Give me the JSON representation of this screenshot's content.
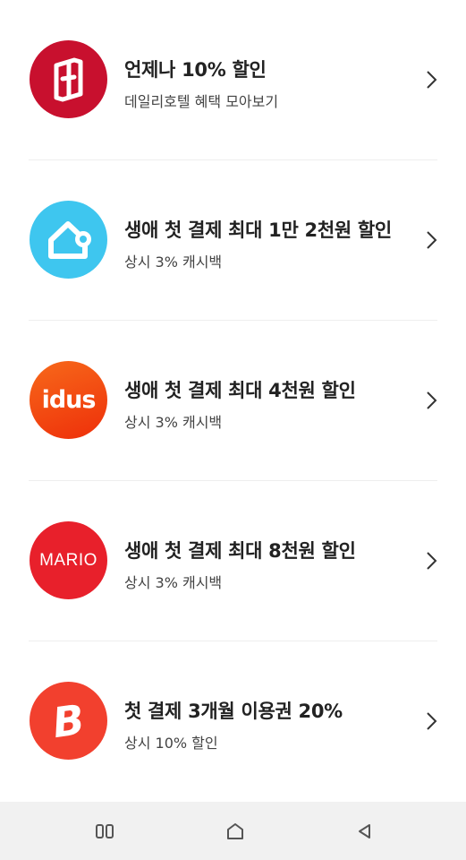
{
  "items": [
    {
      "title": "언제나 10% 할인",
      "subtitle": "데일리호텔 혜택 모아보기",
      "logo_icon": "dailyhotel-logo-icon",
      "logo_color": "#C8102E"
    },
    {
      "title": "생애 첫 결제 최대 1만 2천원 할인",
      "subtitle": "상시 3% 캐시백",
      "logo_icon": "house-logo-icon",
      "logo_color": "#3EC6EF"
    },
    {
      "title": "생애 첫 결제 최대 4천원 할인",
      "subtitle": "상시 3% 캐시백",
      "logo_icon": "idus-logo-icon",
      "logo_text": "idus",
      "logo_color": "#F2470F"
    },
    {
      "title": "생애 첫 결제 최대 8천원 할인",
      "subtitle": "상시 3% 캐시백",
      "logo_icon": "mario-logo-icon",
      "logo_text": "MARIO",
      "logo_color": "#E8202B"
    },
    {
      "title": "첫 결제 3개월 이용권 20%",
      "subtitle": "상시 10% 할인",
      "logo_icon": "b-logo-icon",
      "logo_text": "B",
      "logo_color": "#F2402E"
    }
  ],
  "navbar": {
    "buttons": [
      "recent-apps-icon",
      "home-icon",
      "back-icon"
    ]
  }
}
